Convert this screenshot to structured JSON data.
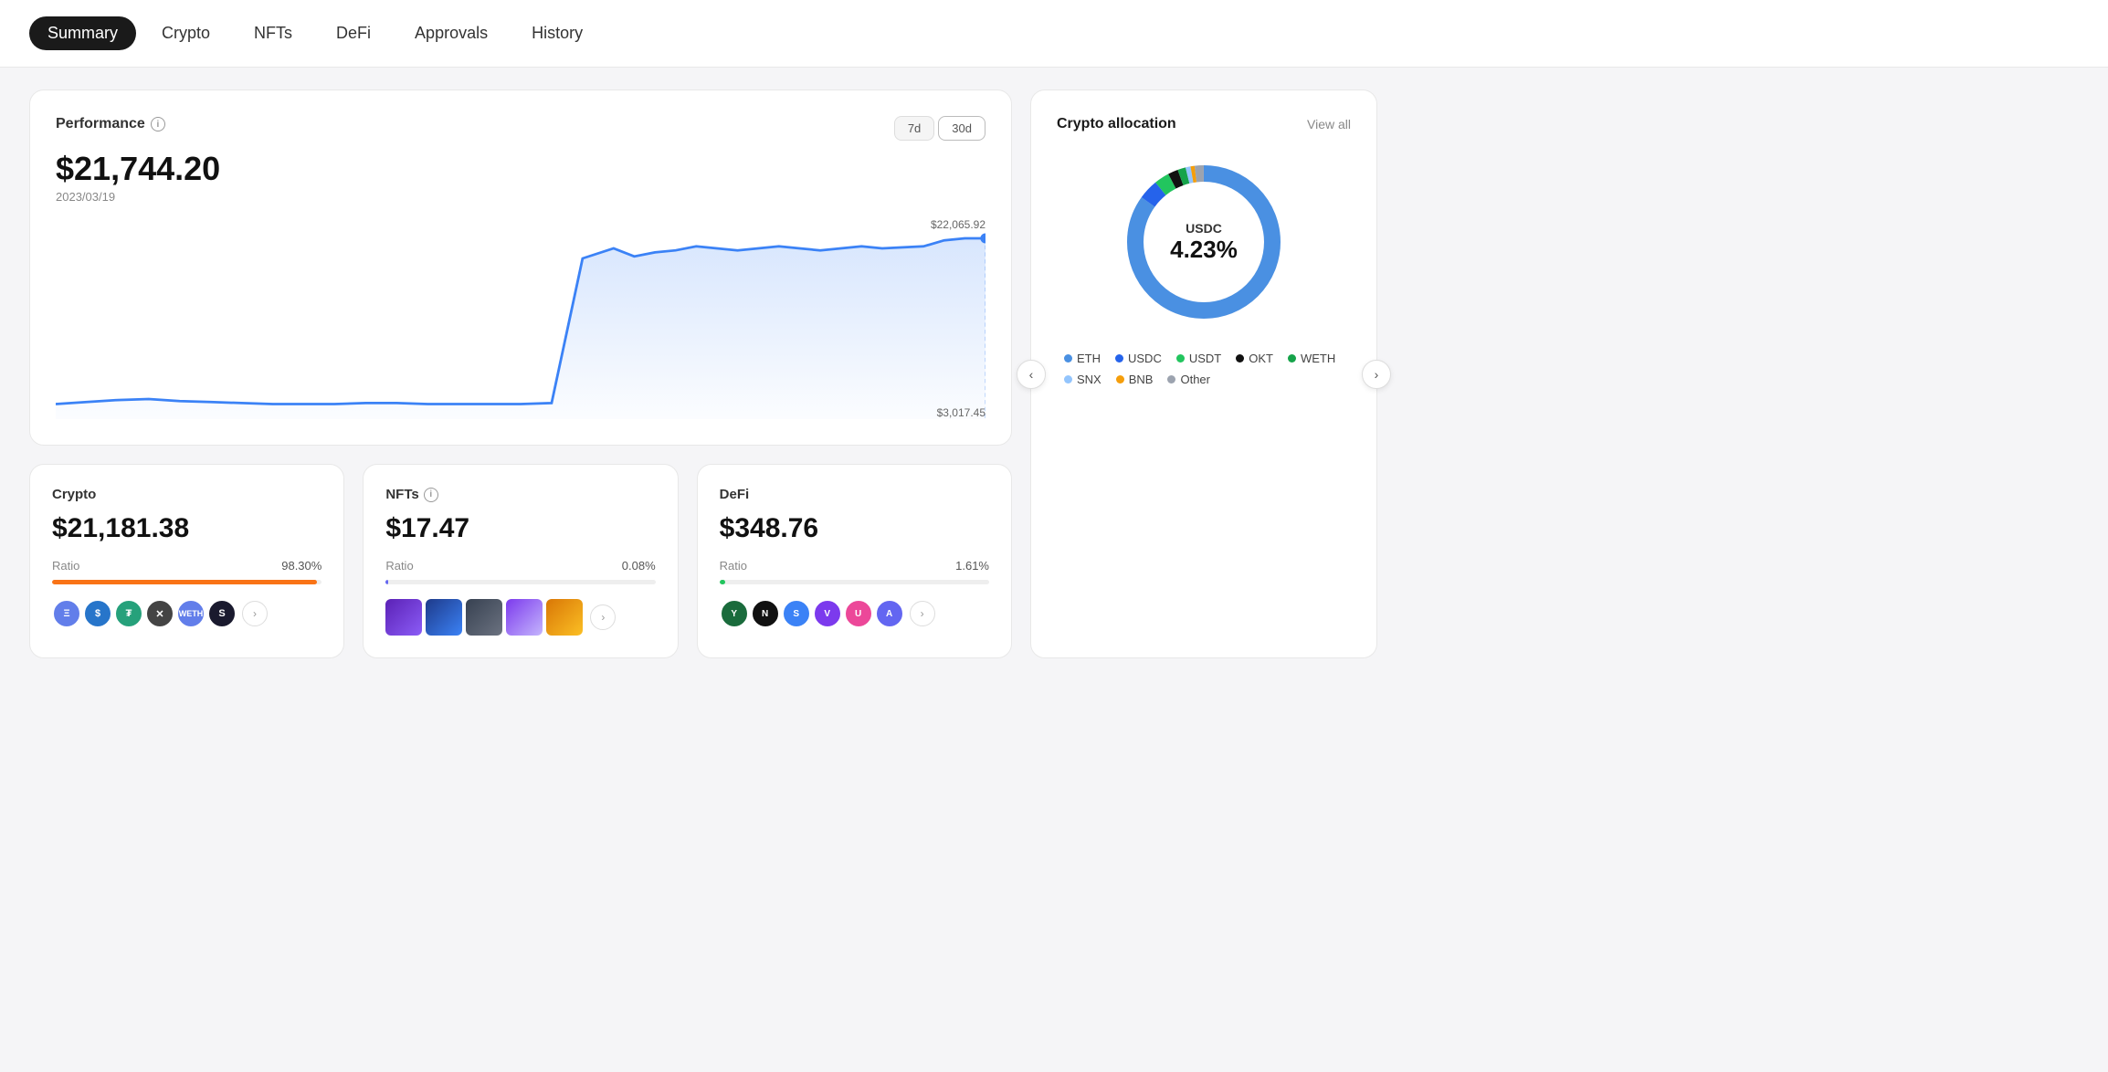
{
  "nav": {
    "items": [
      {
        "label": "Summary",
        "active": true
      },
      {
        "label": "Crypto",
        "active": false
      },
      {
        "label": "NFTs",
        "active": false
      },
      {
        "label": "DeFi",
        "active": false
      },
      {
        "label": "Approvals",
        "active": false
      },
      {
        "label": "History",
        "active": false
      }
    ]
  },
  "performance": {
    "title": "Performance",
    "amount": "$21,744.20",
    "date": "2023/03/19",
    "time_buttons": [
      "7d",
      "30d"
    ],
    "active_time": "30d",
    "chart_max": "$22,065.92",
    "chart_min": "$3,017.45"
  },
  "allocation": {
    "title": "Crypto allocation",
    "view_all": "View all",
    "center_label": "USDC",
    "center_pct": "4.23%",
    "legend": [
      {
        "label": "ETH",
        "color": "#4A90E2"
      },
      {
        "label": "USDC",
        "color": "#2563EB"
      },
      {
        "label": "USDT",
        "color": "#22c55e"
      },
      {
        "label": "OKT",
        "color": "#111111"
      },
      {
        "label": "WETH",
        "color": "#16a34a"
      },
      {
        "label": "SNX",
        "color": "#93c5fd"
      },
      {
        "label": "BNB",
        "color": "#f59e0b"
      },
      {
        "label": "Other",
        "color": "#9ca3af"
      }
    ]
  },
  "crypto_card": {
    "title": "Crypto",
    "amount": "$21,181.38",
    "ratio_label": "Ratio",
    "ratio_pct": "98.30%",
    "bar_color": "#f97316",
    "bar_width": "98.3"
  },
  "nfts_card": {
    "title": "NFTs",
    "amount": "$17.47",
    "ratio_label": "Ratio",
    "ratio_pct": "0.08%",
    "bar_color": "#6366f1",
    "bar_width": "0.08"
  },
  "defi_card": {
    "title": "DeFi",
    "amount": "$348.76",
    "ratio_label": "Ratio",
    "ratio_pct": "1.61%",
    "bar_color": "#22c55e",
    "bar_width": "1.61"
  }
}
